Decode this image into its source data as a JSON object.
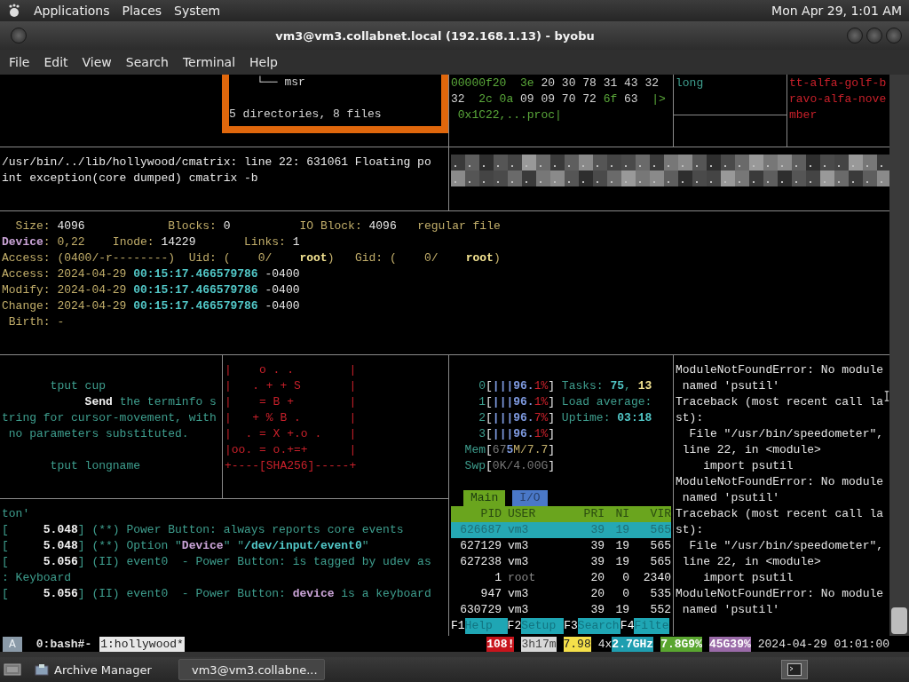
{
  "top_panel": {
    "menus": [
      "Applications",
      "Places",
      "System"
    ],
    "clock": "Mon Apr 29, 1:01 AM"
  },
  "window": {
    "title": "vm3@vm3.collabnet.local (192.168.1.13) - byobu"
  },
  "menu_bar": [
    "File",
    "Edit",
    "View",
    "Search",
    "Terminal",
    "Help"
  ],
  "tree_pane": {
    "lines": [
      [
        {
          "text": "    └── msr",
          "kind": "text"
        }
      ],
      [
        {
          "text": "5 directories, 8 files",
          "kind": "text"
        }
      ]
    ]
  },
  "hex_pane": {
    "lines": [
      [
        {
          "text": "00000f20  3e ",
          "kind": "green"
        },
        {
          "text": "20 30 78 31 43 32",
          "kind": "text"
        }
      ],
      [
        {
          "text": "32  ",
          "kind": "text"
        },
        {
          "text": "2c 0a ",
          "kind": "green"
        },
        {
          "text": "09 09 70 72 ",
          "kind": "text"
        },
        {
          "text": "6f ",
          "kind": "green"
        },
        {
          "text": "63  ",
          "kind": "text"
        },
        {
          "text": "|>",
          "kind": "green"
        }
      ],
      [
        {
          "text": " 0x1C22,...proc|",
          "kind": "green"
        }
      ]
    ]
  },
  "long_pane": {
    "lines": [
      [
        {
          "text": "long",
          "kind": "man"
        }
      ]
    ]
  },
  "word_pane": {
    "lines": [
      [
        {
          "text": "tt-alfa-golf-b",
          "kind": "red"
        }
      ],
      [
        {
          "text": "ravo-alfa-nove",
          "kind": "red"
        }
      ],
      [
        {
          "text": "mber",
          "kind": "red"
        }
      ]
    ]
  },
  "cmatrix_pane": {
    "lines": [
      [
        {
          "text": "/usr/bin/../lib/hollywood/cmatrix: line 22: 631061 Floating po",
          "kind": "bright"
        }
      ],
      [
        {
          "text": "int exception(core dumped) cmatrix -b",
          "kind": "bright"
        }
      ]
    ]
  },
  "stat_pane": {
    "lines": [
      [
        {
          "text": "  Size: ",
          "kind": "label"
        },
        {
          "text": "4096",
          "kind": "bright"
        },
        {
          "text": "            Blocks: ",
          "kind": "label"
        },
        {
          "text": "0",
          "kind": "bright"
        },
        {
          "text": "          IO Block: ",
          "kind": "label"
        },
        {
          "text": "4096",
          "kind": "bright"
        },
        {
          "text": "   regular file",
          "kind": "label"
        }
      ],
      [
        {
          "text": "Device",
          "kind": "device"
        },
        {
          "text": ": 0,22    Inode: ",
          "kind": "label"
        },
        {
          "text": "14229",
          "kind": "bright"
        },
        {
          "text": "       Links: ",
          "kind": "label"
        },
        {
          "text": "1",
          "kind": "bright"
        }
      ],
      [
        {
          "text": "Access: (0400/-r--------)  Uid: (    0/    ",
          "kind": "label"
        },
        {
          "text": "root",
          "kind": "strong"
        },
        {
          "text": ")   Gid: (    0/    ",
          "kind": "label"
        },
        {
          "text": "root",
          "kind": "strong"
        },
        {
          "text": ")",
          "kind": "label"
        }
      ],
      [
        {
          "text": "Access: 2024-04-29 ",
          "kind": "label"
        },
        {
          "text": "00:15:17.466579786",
          "kind": "time"
        },
        {
          "text": " -0400",
          "kind": "bright"
        }
      ],
      [
        {
          "text": "Modify: 2024-04-29 ",
          "kind": "label"
        },
        {
          "text": "00:15:17.466579786",
          "kind": "time"
        },
        {
          "text": " -0400",
          "kind": "bright"
        }
      ],
      [
        {
          "text": "Change: 2024-04-29 ",
          "kind": "label"
        },
        {
          "text": "00:15:17.466579786",
          "kind": "time"
        },
        {
          "text": " -0400",
          "kind": "bright"
        }
      ],
      [
        {
          "text": " Birth: -",
          "kind": "label"
        }
      ]
    ]
  },
  "tput_pane": {
    "lines": [
      [
        {
          "text": "       tput cup",
          "kind": "man"
        }
      ],
      [
        {
          "text": "            Send",
          "kind": "bold"
        },
        {
          "text": " the terminfo s",
          "kind": "man"
        }
      ],
      [
        {
          "text": "tring for cursor-movement, with",
          "kind": "man"
        }
      ],
      [
        {
          "text": " no parameters substituted.",
          "kind": "man"
        }
      ],
      [
        {
          "text": "       tput longname",
          "kind": "man"
        }
      ]
    ]
  },
  "key_art_pane": {
    "lines": [
      [
        {
          "text": "|    o . .        |",
          "kind": "red"
        }
      ],
      [
        {
          "text": "|   . + + S       |",
          "kind": "red"
        }
      ],
      [
        {
          "text": "|    = B +        |",
          "kind": "red"
        }
      ],
      [
        {
          "text": "|   + % B .       |",
          "kind": "red"
        }
      ],
      [
        {
          "text": "|  . = X +.o .    |",
          "kind": "red"
        }
      ],
      [
        {
          "text": "|oo. = o.+=+      |",
          "kind": "red"
        }
      ],
      [
        {
          "text": "+----[SHA256]-----+",
          "kind": "red"
        }
      ]
    ]
  },
  "htop": {
    "meters": [
      [
        {
          "text": "    0",
          "kind": "man"
        },
        {
          "text": "[",
          "kind": "bright"
        },
        {
          "text": "|||96.",
          "kind": "blue"
        },
        {
          "text": "1%",
          "kind": "red"
        },
        {
          "text": "]",
          "kind": "bright"
        },
        {
          "text": " Tasks: ",
          "kind": "man"
        },
        {
          "text": "75",
          "kind": "time"
        },
        {
          "text": ", ",
          "kind": "man"
        },
        {
          "text": "13",
          "kind": "strong"
        }
      ],
      [
        {
          "text": "    1",
          "kind": "man"
        },
        {
          "text": "[",
          "kind": "bright"
        },
        {
          "text": "|||96.",
          "kind": "blue"
        },
        {
          "text": "1%",
          "kind": "red"
        },
        {
          "text": "]",
          "kind": "bright"
        },
        {
          "text": " Load average:",
          "kind": "man"
        }
      ],
      [
        {
          "text": "    2",
          "kind": "man"
        },
        {
          "text": "[",
          "kind": "bright"
        },
        {
          "text": "|||96.",
          "kind": "blue"
        },
        {
          "text": "7%",
          "kind": "red"
        },
        {
          "text": "]",
          "kind": "bright"
        },
        {
          "text": " Uptime: ",
          "kind": "man"
        },
        {
          "text": "03:18",
          "kind": "time"
        }
      ],
      [
        {
          "text": "    3",
          "kind": "man"
        },
        {
          "text": "[",
          "kind": "bright"
        },
        {
          "text": "|||96.",
          "kind": "blue"
        },
        {
          "text": "1%",
          "kind": "red"
        },
        {
          "text": "]",
          "kind": "bright"
        }
      ],
      [
        {
          "text": "  Mem",
          "kind": "man"
        },
        {
          "text": "[",
          "kind": "bright"
        },
        {
          "text": "67",
          "kind": "dim"
        },
        {
          "text": "5",
          "kind": "blue"
        },
        {
          "text": "M/7.7",
          "kind": "label"
        },
        {
          "text": "]",
          "kind": "bright"
        }
      ],
      [
        {
          "text": "  Swp",
          "kind": "man"
        },
        {
          "text": "[",
          "kind": "bright"
        },
        {
          "text": "0K/4.00G",
          "kind": "dim"
        },
        {
          "text": "]",
          "kind": "bright"
        }
      ]
    ],
    "tabs": [
      {
        "label": "Main",
        "selected": true
      },
      {
        "label": "I/O",
        "selected": false
      }
    ],
    "columns": [
      "PID",
      "USER",
      "PRI",
      "NI",
      "VIR"
    ],
    "rows": [
      {
        "cells": [
          "626687",
          "vm3",
          "39",
          "19",
          "565"
        ],
        "selected": true
      },
      {
        "cells": [
          "627129",
          "vm3",
          "39",
          "19",
          "565"
        ],
        "selected": false
      },
      {
        "cells": [
          "627238",
          "vm3",
          "39",
          "19",
          "565"
        ],
        "selected": false
      },
      {
        "cells": [
          "1",
          "root",
          "20",
          "0",
          "2340"
        ],
        "selected": false
      },
      {
        "cells": [
          "947",
          "vm3",
          "20",
          "0",
          "535"
        ],
        "selected": false
      },
      {
        "cells": [
          "630729",
          "vm3",
          "39",
          "19",
          "552"
        ],
        "selected": false
      }
    ],
    "function_keys": [
      {
        "key": "F1",
        "label": "Help"
      },
      {
        "key": "F2",
        "label": "Setup"
      },
      {
        "key": "F3",
        "label": "Search"
      },
      {
        "key": "F4",
        "label": "Filte"
      }
    ]
  },
  "python_pane": {
    "lines": [
      "ModuleNotFoundError: No module",
      " named 'psutil'",
      "Traceback (most recent call la",
      "st):",
      "  File \"/usr/bin/speedometer\",",
      " line 22, in <module>",
      "    import psutil",
      "ModuleNotFoundError: No module",
      " named 'psutil'",
      "Traceback (most recent call la",
      "st):",
      "  File \"/usr/bin/speedometer\",",
      " line 22, in <module>",
      "    import psutil",
      "ModuleNotFoundError: No module",
      " named 'psutil'"
    ]
  },
  "log_pane": {
    "lines": [
      [
        {
          "text": "ton'",
          "kind": "man"
        }
      ],
      [
        {
          "text": "[     ",
          "kind": "man"
        },
        {
          "text": "5.048",
          "kind": "bold"
        },
        {
          "text": "] (**) Power Button: always reports core events",
          "kind": "man"
        }
      ],
      [
        {
          "text": "[     ",
          "kind": "man"
        },
        {
          "text": "5.048",
          "kind": "bold"
        },
        {
          "text": "] (**) Option \"",
          "kind": "man"
        },
        {
          "text": "Device",
          "kind": "device"
        },
        {
          "text": "\" \"",
          "kind": "man"
        },
        {
          "text": "/dev/input/event0",
          "kind": "time"
        },
        {
          "text": "\"",
          "kind": "man"
        }
      ],
      [
        {
          "text": "[     ",
          "kind": "man"
        },
        {
          "text": "5.056",
          "kind": "bold"
        },
        {
          "text": "] (II) event0  - Power Button: is tagged by udev as",
          "kind": "man"
        }
      ],
      [
        {
          "text": ": Keyboard",
          "kind": "man"
        }
      ],
      [
        {
          "text": "[     ",
          "kind": "man"
        },
        {
          "text": "5.056",
          "kind": "bold"
        },
        {
          "text": "] (II) event0  - Power Button: ",
          "kind": "man"
        },
        {
          "text": "device",
          "kind": "device"
        },
        {
          "text": " is a keyboard",
          "kind": "man"
        }
      ]
    ]
  },
  "status_bar": {
    "session": "A",
    "windows": [
      {
        "label": "0:bash#-",
        "selected": false
      },
      {
        "label": "1:hollywood*",
        "selected": true
      }
    ],
    "indicators": [
      {
        "text": "108!",
        "kind": "alert"
      },
      {
        "text": "3h17m",
        "kind": "uptime"
      },
      {
        "text": "7.98",
        "kind": "load"
      },
      {
        "text": "4x",
        "kind": "plain"
      },
      {
        "text": "2.7GHz",
        "kind": "cpu"
      },
      {
        "text": "7.8G9%",
        "kind": "memory"
      },
      {
        "text": "45G39%",
        "kind": "disk"
      },
      {
        "text": "2024-04-29 01:01:00",
        "kind": "plain"
      }
    ]
  },
  "taskbar": {
    "items": [
      {
        "label": "Archive Manager",
        "selected": false
      },
      {
        "label": "vm3@vm3.collabne...",
        "selected": true
      }
    ]
  }
}
